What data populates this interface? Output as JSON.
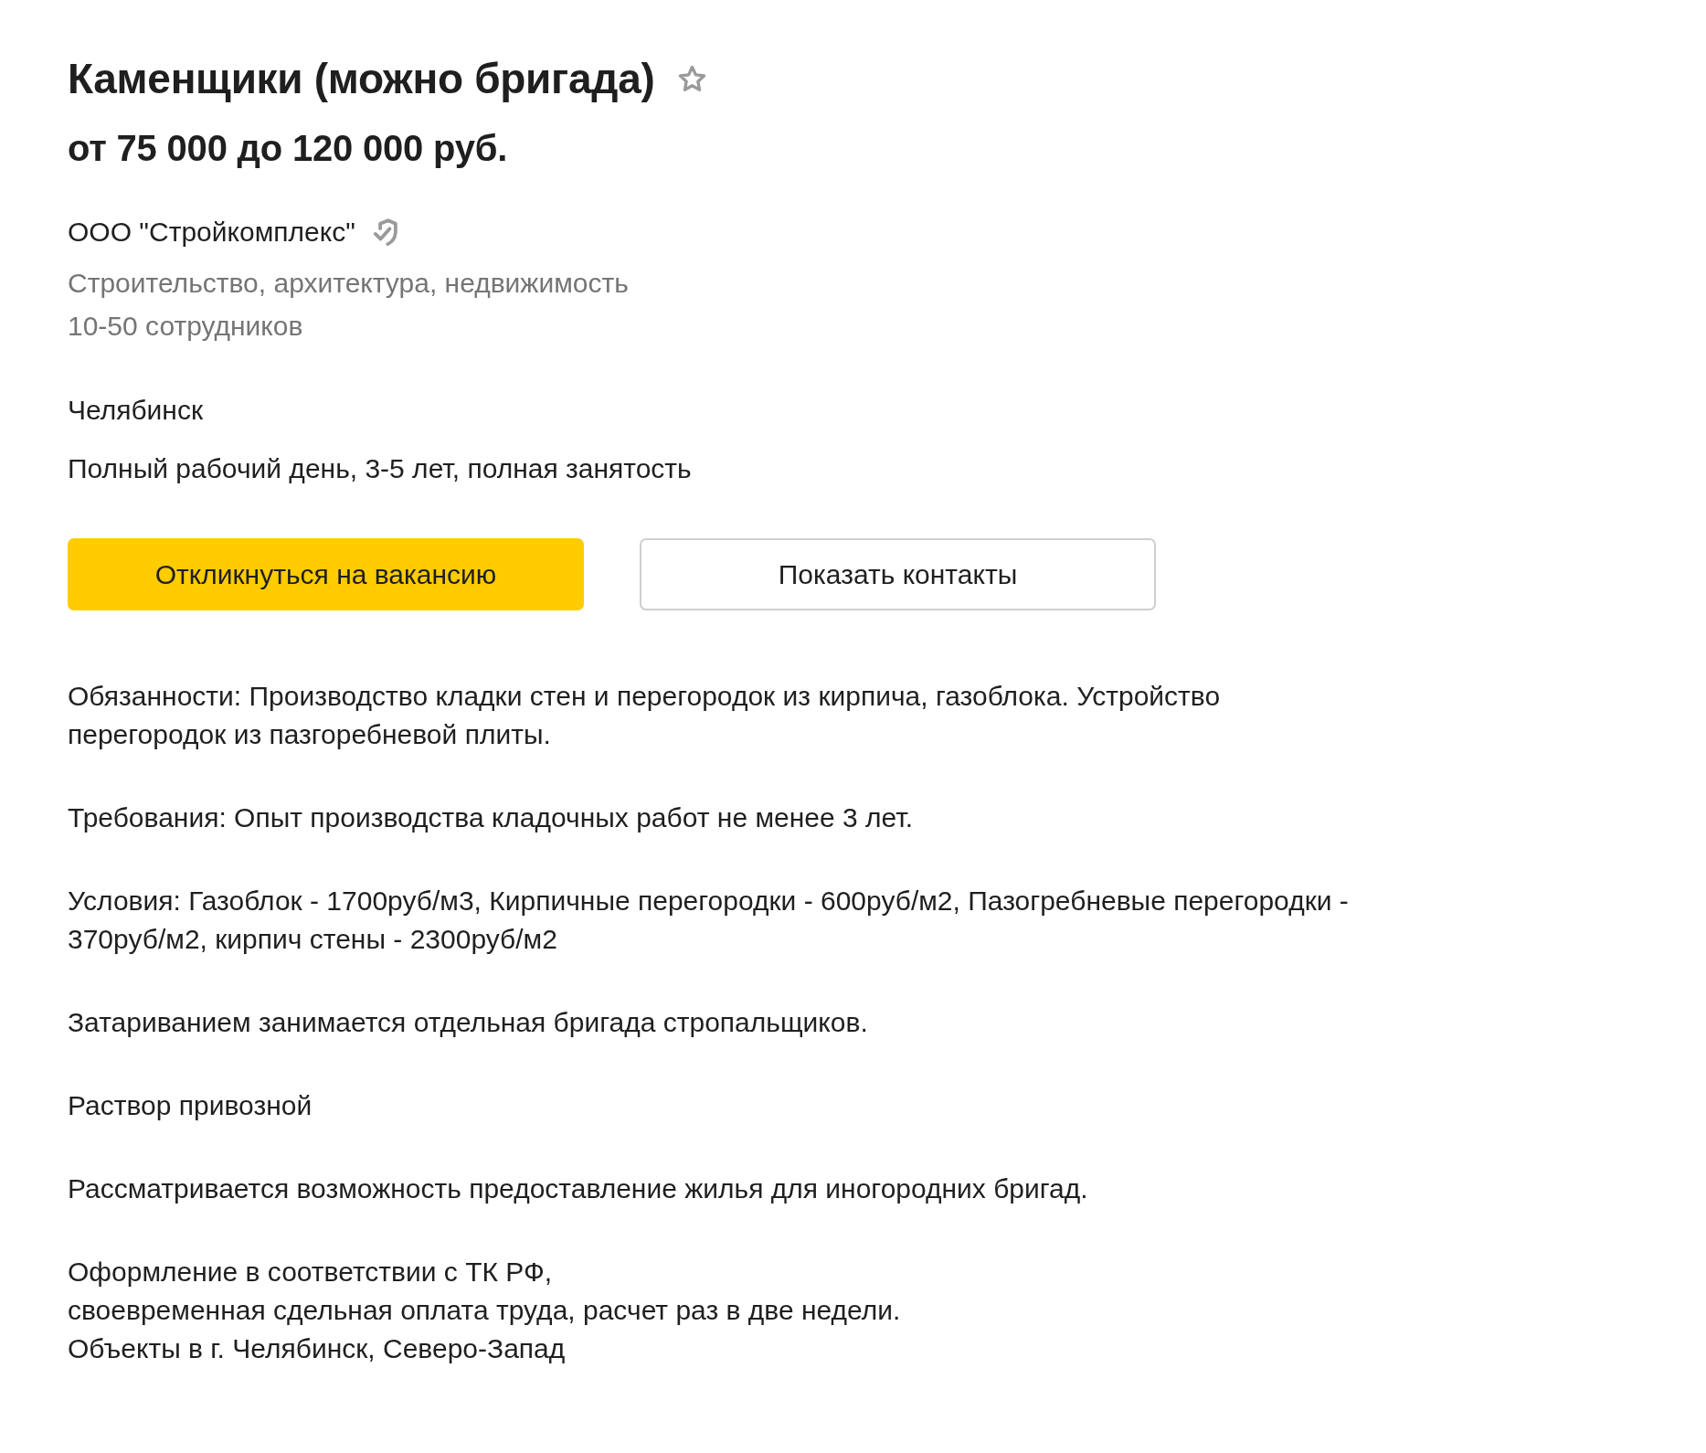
{
  "vacancy": {
    "title": "Каменщики (можно бригада)",
    "salary": "от 75 000 до 120 000 руб."
  },
  "company": {
    "name": "ООО \"Стройкомплекс\"",
    "verified": true,
    "industry": "Строительство, архитектура, недвижимость",
    "size": "10-50 сотрудников"
  },
  "location": "Челябинск",
  "employment": "Полный рабочий день, 3-5 лет, полная занятость",
  "buttons": [
    {
      "label": "Откликнуться на вакансию",
      "kind": "primary"
    },
    {
      "label": "Показать контакты",
      "kind": "secondary"
    }
  ],
  "description": [
    "Обязанности: Производство кладки стен и перегородок из кирпича, газоблока. Устройство перегородок из пазгоребневой плиты.",
    "Требования: Опыт производства кладочных работ не менее 3 лет.",
    "Условия: Газоблок - 1700руб/м3, Кирпичные перегородки - 600руб/м2, Пазогребневые перегородки - 370руб/м2, кирпич стены - 2300руб/м2",
    "Затариванием занимается отдельная бригада стропальщиков.",
    "Раствор привозной",
    "Рассматривается возможность предоставление жилья для иногородних бригад.",
    "Оформление в соответствии с ТК РФ,\nсвоевременная сдельная оплата труда, расчет раз в две недели.\nОбъекты в г. Челябинск, Северо-Запад"
  ]
}
